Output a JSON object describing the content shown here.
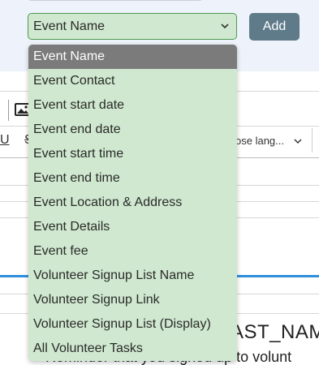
{
  "field_select": {
    "selected": "Event Name"
  },
  "add_button": {
    "label": "Add"
  },
  "editor": {
    "underline_glyph": "U",
    "strike_glyph": "S",
    "language_select": "ose lang...",
    "body_heading": "AST_NAME",
    "body_text": "Reminder that you signed up to volunt"
  },
  "dropdown": {
    "options": [
      "Event Name",
      "Event Contact",
      "Event start date",
      "Event end date",
      "Event start time",
      "Event end time",
      "Event Location & Address",
      "Event Details",
      "Event fee",
      "Volunteer Signup List Name",
      "Volunteer Signup Link",
      "Volunteer Signup List (Display)",
      "All Volunteer Tasks"
    ]
  },
  "colors": {
    "select_bg": "#cfe8cf",
    "select_border": "#4e9a4e",
    "selected_option_bg": "#7b7b7b",
    "add_button_bg": "#5f7b8a",
    "accent_line": "#2f8fdd",
    "top_panel_bg": "#eef3fb"
  }
}
